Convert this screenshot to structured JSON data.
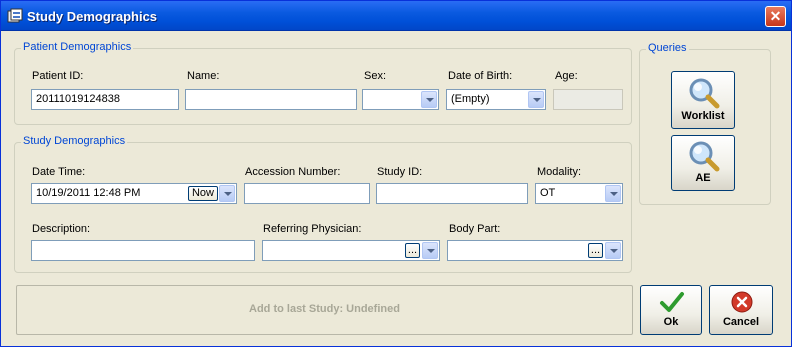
{
  "window": {
    "title": "Study Demographics",
    "close_label": "✕"
  },
  "patient": {
    "legend": "Patient Demographics",
    "patient_id_label": "Patient ID:",
    "patient_id_value": "20111019124838",
    "name_label": "Name:",
    "name_value": "",
    "sex_label": "Sex:",
    "sex_value": "",
    "dob_label": "Date of Birth:",
    "dob_value": "(Empty)",
    "age_label": "Age:",
    "age_value": ""
  },
  "study": {
    "legend": "Study Demographics",
    "datetime_label": "Date Time:",
    "datetime_value": "10/19/2011 12:48 PM",
    "now_label": "Now",
    "accession_label": "Accession Number:",
    "accession_value": "",
    "studyid_label": "Study ID:",
    "studyid_value": "",
    "modality_label": "Modality:",
    "modality_value": "OT",
    "description_label": "Description:",
    "description_value": "",
    "referring_label": "Referring Physician:",
    "referring_value": "",
    "bodypart_label": "Body Part:",
    "bodypart_value": "",
    "ellipsis_label": "..."
  },
  "queries": {
    "legend": "Queries",
    "worklist_label": "Worklist",
    "ae_label": "AE"
  },
  "status": {
    "add_to_last_label": "Add to last Study: Undefined"
  },
  "actions": {
    "ok_label": "Ok",
    "cancel_label": "Cancel"
  },
  "icons": {
    "magnifier": "magnifier-icon",
    "ok": "checkmark-icon",
    "cancel": "cancel-icon",
    "app": "app-icon"
  }
}
